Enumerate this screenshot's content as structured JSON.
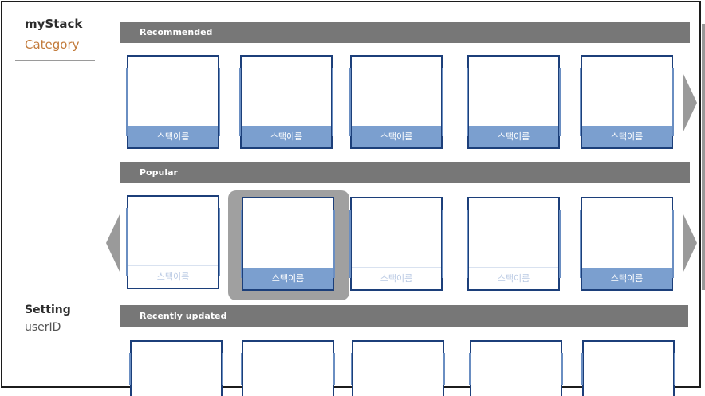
{
  "sidebar": {
    "brand": "myStack",
    "category": "Category",
    "setting": "Setting",
    "user": "userID"
  },
  "sections": [
    {
      "title": "Recommended",
      "cards": [
        "스택이름",
        "스택이름",
        "스택이름",
        "스택이름",
        "스택이름"
      ]
    },
    {
      "title": "Popular",
      "cards": [
        "스택이름",
        "스택이름",
        "스택이름",
        "스택이름",
        "스택이름"
      ]
    },
    {
      "title": "Recently updated",
      "cards": []
    }
  ],
  "colors": {
    "bar": "#777777",
    "card_border": "#1c3f7a",
    "card_label": "#7b9fcf",
    "accent": "#c27a3a"
  }
}
